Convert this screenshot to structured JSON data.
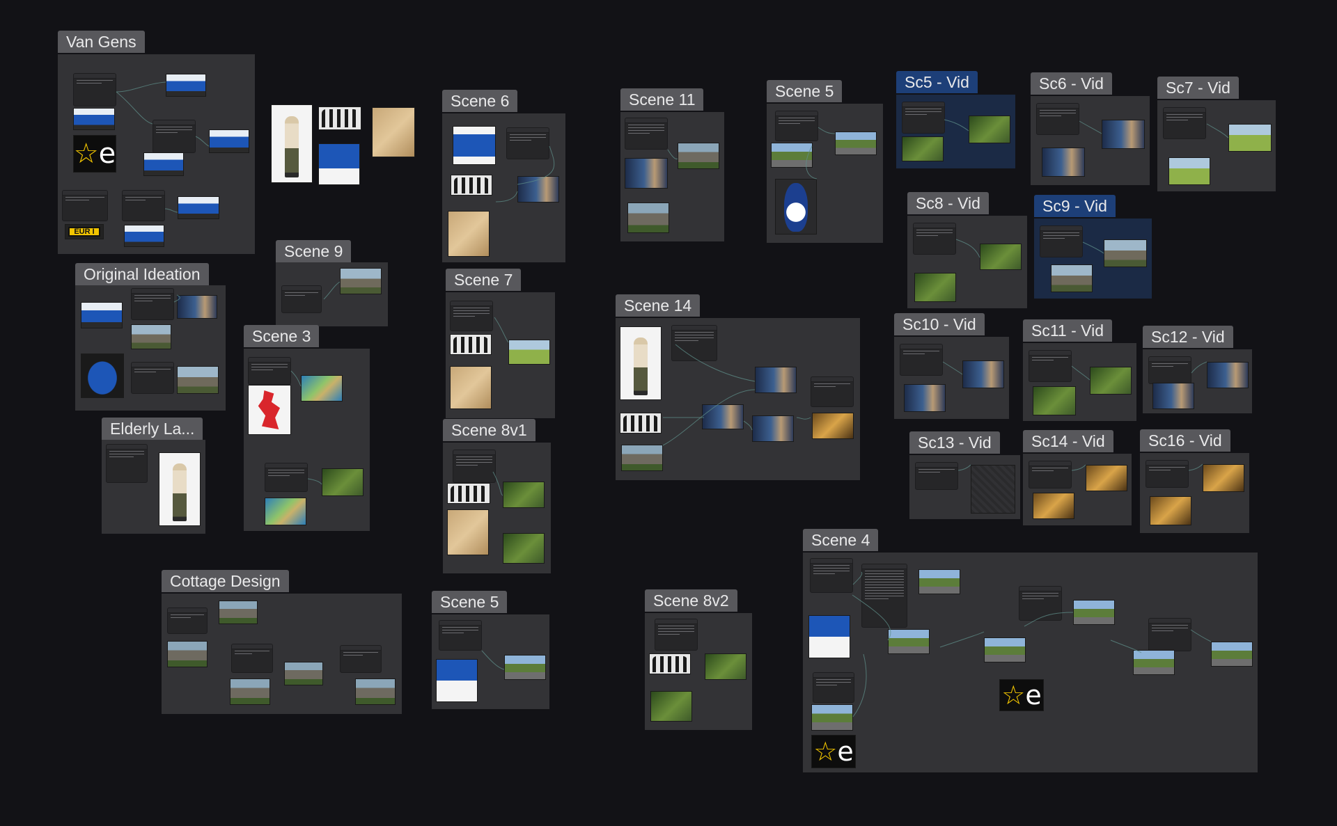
{
  "groups": {
    "van_gens": "Van Gens",
    "original_ideation": "Original Ideation",
    "elderly_la": "Elderly La...",
    "cottage_design": "Cottage Design",
    "scene_9": "Scene 9",
    "scene_3": "Scene 3",
    "scene_6": "Scene 6",
    "scene_7": "Scene 7",
    "scene_8v1": "Scene 8v1",
    "scene_5_bottom": "Scene 5",
    "scene_11": "Scene 11",
    "scene_14": "Scene 14",
    "scene_8v2": "Scene 8v2",
    "scene_5_top": "Scene 5",
    "scene_4": "Scene 4",
    "sc5_vid": "Sc5 - Vid",
    "sc6_vid": "Sc6 - Vid",
    "sc7_vid": "Sc7 - Vid",
    "sc8_vid": "Sc8 - Vid",
    "sc9_vid": "Sc9 - Vid",
    "sc10_vid": "Sc10 - Vid",
    "sc11_vid": "Sc11 - Vid",
    "sc12_vid": "Sc12 - Vid",
    "sc13_vid": "Sc13 - Vid",
    "sc14_vid": "Sc14 - Vid",
    "sc16_vid": "Sc16 - Vid"
  },
  "logo": {
    "letter": "e",
    "star": "☆"
  },
  "plate_text": "EUR I",
  "colors": {
    "canvas_bg": "#121216",
    "group_bg": "#333336",
    "group_bg_selected": "#1b2a45",
    "label_bg": "#58585c",
    "label_bg_selected": "#1d3f78",
    "wire": "#5f8f8a",
    "brand_blue": "#1d56b7",
    "brand_yellow": "#f2c500"
  }
}
